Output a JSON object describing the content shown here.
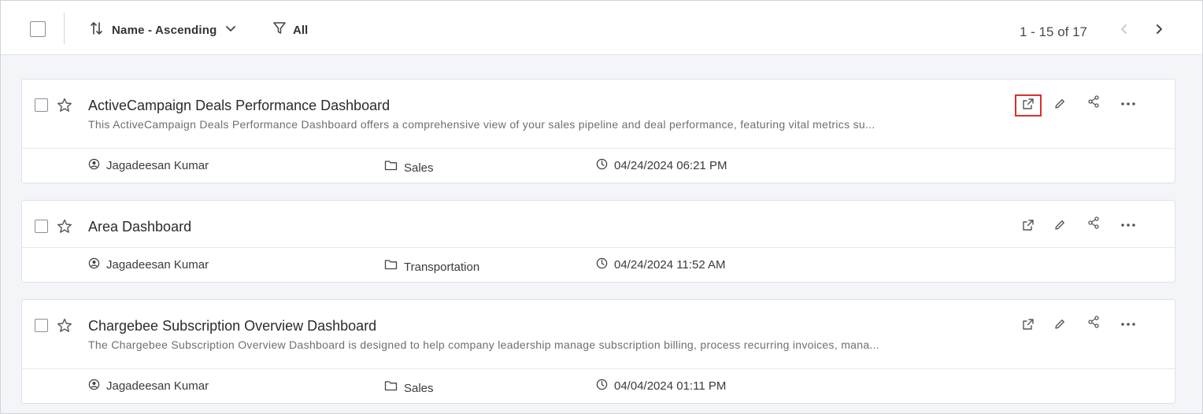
{
  "toolbar": {
    "sort_label": "Name - Ascending",
    "filter_label": "All",
    "pagination": "1 - 15 of 17"
  },
  "cards": [
    {
      "title": "ActiveCampaign Deals Performance Dashboard",
      "description": "This ActiveCampaign Deals Performance Dashboard offers a comprehensive view of your sales pipeline and deal performance, featuring vital metrics su...",
      "owner": "Jagadeesan Kumar",
      "category": "Sales",
      "modified": "04/24/2024 06:21 PM"
    },
    {
      "title": "Area Dashboard",
      "description": "",
      "owner": "Jagadeesan Kumar",
      "category": "Transportation",
      "modified": "04/24/2024 11:52 AM"
    },
    {
      "title": "Chargebee Subscription Overview Dashboard",
      "description": "The Chargebee Subscription Overview Dashboard is designed to help company leadership manage subscription billing, process recurring invoices, mana...",
      "owner": "Jagadeesan Kumar",
      "category": "Sales",
      "modified": "04/04/2024 01:11 PM"
    }
  ],
  "colors": {
    "highlight": "#d9302f",
    "background": "#f3f5f8",
    "card": "#ffffff"
  }
}
